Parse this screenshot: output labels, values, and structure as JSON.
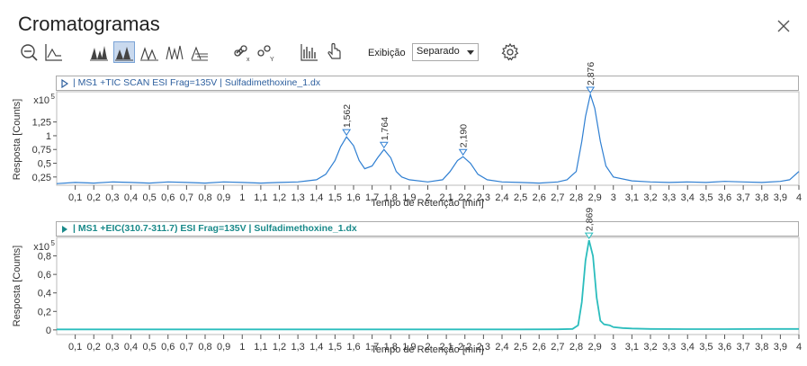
{
  "window": {
    "title": "Cromatogramas"
  },
  "toolbar": {
    "exibicao_label": "Exibição",
    "exibicao_value": "Separado",
    "icons": [
      "zoom-out-icon",
      "baseline-icon",
      "peaks-filled-icon",
      "peaks-filled-icon",
      "peaks-outline-icon",
      "peaks-overlay-icon",
      "peaks-stacked-icon",
      "link-x-icon",
      "link-y-icon",
      "bar-chart-icon",
      "hand-pointer-icon",
      "gear-icon"
    ]
  },
  "colors": {
    "tic": "#2f7fd2",
    "eic": "#2bbdbd",
    "axis": "#555555",
    "grid": "#dddddd"
  },
  "chart_data": [
    {
      "type": "line",
      "title": "| MS1 +TIC SCAN ESI Frag=135V | Sulfadimethoxine_1.dx",
      "xlabel": "Tempo de Retenção [min]",
      "ylabel": "Resposta [Counts]",
      "yscale_label": "x10",
      "yscale_exp": "5",
      "xlim": [
        0,
        4
      ],
      "ylim": [
        0.1,
        1.8
      ],
      "xticks": [
        "0,1",
        "0,2",
        "0,3",
        "0,4",
        "0,5",
        "0,6",
        "0,7",
        "0,8",
        "0,9",
        "1",
        "1,1",
        "1,2",
        "1,3",
        "1,4",
        "1,5",
        "1,6",
        "1,7",
        "1,8",
        "1,9",
        "2",
        "2,1",
        "2,2",
        "2,3",
        "2,4",
        "2,5",
        "2,6",
        "2,7",
        "2,8",
        "2,9",
        "3",
        "3,1",
        "3,2",
        "3,3",
        "3,4",
        "3,5",
        "3,6",
        "3,7",
        "3,8",
        "3,9",
        "4"
      ],
      "yticks": [
        "0,25",
        "0,5",
        "0,75",
        "1",
        "1,25"
      ],
      "ytick_values": [
        0.25,
        0.5,
        0.75,
        1,
        1.25
      ],
      "peaks": [
        {
          "label": "1,562",
          "x": 1.562,
          "y": 0.98
        },
        {
          "label": "1,764",
          "x": 1.764,
          "y": 0.75
        },
        {
          "label": "2,190",
          "x": 2.19,
          "y": 0.62
        },
        {
          "label": "2,876",
          "x": 2.876,
          "y": 1.75
        }
      ],
      "series": [
        {
          "x": [
            0,
            0.1,
            0.2,
            0.3,
            0.4,
            0.5,
            0.6,
            0.7,
            0.8,
            0.9,
            1.0,
            1.1,
            1.2,
            1.3,
            1.35,
            1.4,
            1.45,
            1.5,
            1.53,
            1.562,
            1.6,
            1.63,
            1.66,
            1.7,
            1.73,
            1.764,
            1.8,
            1.83,
            1.86,
            1.9,
            2.0,
            2.08,
            2.12,
            2.16,
            2.19,
            2.23,
            2.27,
            2.32,
            2.4,
            2.5,
            2.6,
            2.7,
            2.75,
            2.8,
            2.83,
            2.85,
            2.876,
            2.9,
            2.93,
            2.96,
            3.0,
            3.1,
            3.2,
            3.3,
            3.4,
            3.5,
            3.6,
            3.7,
            3.8,
            3.9,
            3.95,
            4.0
          ],
          "y": [
            0.13,
            0.15,
            0.14,
            0.16,
            0.15,
            0.14,
            0.16,
            0.15,
            0.14,
            0.16,
            0.15,
            0.14,
            0.15,
            0.16,
            0.18,
            0.2,
            0.3,
            0.55,
            0.8,
            0.98,
            0.82,
            0.55,
            0.4,
            0.45,
            0.6,
            0.75,
            0.6,
            0.35,
            0.25,
            0.2,
            0.16,
            0.2,
            0.35,
            0.55,
            0.62,
            0.5,
            0.3,
            0.2,
            0.16,
            0.15,
            0.14,
            0.16,
            0.2,
            0.35,
            0.9,
            1.35,
            1.75,
            1.5,
            0.9,
            0.45,
            0.25,
            0.18,
            0.16,
            0.15,
            0.16,
            0.15,
            0.17,
            0.16,
            0.15,
            0.17,
            0.2,
            0.35
          ]
        }
      ]
    },
    {
      "type": "line",
      "title": "| MS1 +EIC(310.7-311.7) ESI Frag=135V | Sulfadimethoxine_1.dx",
      "xlabel": "Tempo de Retenção [min]",
      "ylabel": "Resposta [Counts]",
      "yscale_label": "x10",
      "yscale_exp": "5",
      "xlim": [
        0,
        4
      ],
      "ylim": [
        -0.05,
        1.0
      ],
      "xticks": [
        "0,1",
        "0,2",
        "0,3",
        "0,4",
        "0,5",
        "0,6",
        "0,7",
        "0,8",
        "0,9",
        "1",
        "1,1",
        "1,2",
        "1,3",
        "1,4",
        "1,5",
        "1,6",
        "1,7",
        "1,8",
        "1,9",
        "2",
        "2,1",
        "2,2",
        "2,3",
        "2,4",
        "2,5",
        "2,6",
        "2,7",
        "2,8",
        "2,9",
        "3",
        "3,1",
        "3,2",
        "3,3",
        "3,4",
        "3,5",
        "3,6",
        "3,7",
        "3,8",
        "3,9",
        "4"
      ],
      "yticks": [
        "0",
        "0,2",
        "0,4",
        "0,6",
        "0,8"
      ],
      "ytick_values": [
        0,
        0.2,
        0.4,
        0.6,
        0.8
      ],
      "peaks": [
        {
          "label": "2,869",
          "x": 2.869,
          "y": 0.97
        }
      ],
      "series": [
        {
          "x": [
            0,
            0.5,
            1.0,
            1.5,
            2.0,
            2.5,
            2.7,
            2.78,
            2.81,
            2.83,
            2.85,
            2.869,
            2.89,
            2.91,
            2.93,
            2.95,
            2.98,
            3.0,
            3.05,
            3.1,
            3.2,
            3.4,
            3.6,
            3.8,
            4.0
          ],
          "y": [
            0.005,
            0.005,
            0.005,
            0.005,
            0.005,
            0.005,
            0.006,
            0.01,
            0.05,
            0.3,
            0.75,
            0.97,
            0.8,
            0.35,
            0.1,
            0.06,
            0.05,
            0.03,
            0.02,
            0.015,
            0.01,
            0.008,
            0.008,
            0.01,
            0.01
          ]
        }
      ]
    }
  ]
}
